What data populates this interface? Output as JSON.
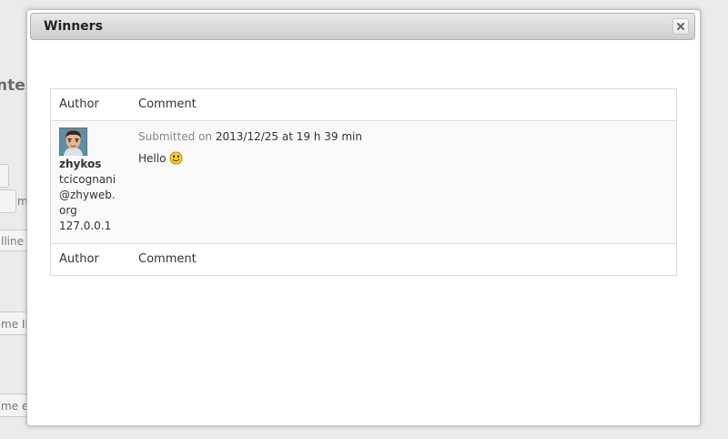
{
  "background": {
    "heading_fragment": "ntes",
    "field_fragments": [
      "m",
      "lline",
      "me IP",
      "me en"
    ]
  },
  "dialog": {
    "title": "Winners",
    "close_icon": "close-icon"
  },
  "table": {
    "header": {
      "author": "Author",
      "comment": "Comment"
    },
    "footer": {
      "author": "Author",
      "comment": "Comment"
    },
    "rows": [
      {
        "avatar_icon": "user-avatar",
        "author_name": "zhykos",
        "author_email": "tcicognani@zhyweb.org",
        "author_ip": "127.0.0.1",
        "submitted_label": "Submitted on",
        "submitted_date": "2013/12/25 at 19 h 39 min",
        "comment_text": "Hello",
        "emoticon_icon": "smiley-icon"
      }
    ]
  }
}
